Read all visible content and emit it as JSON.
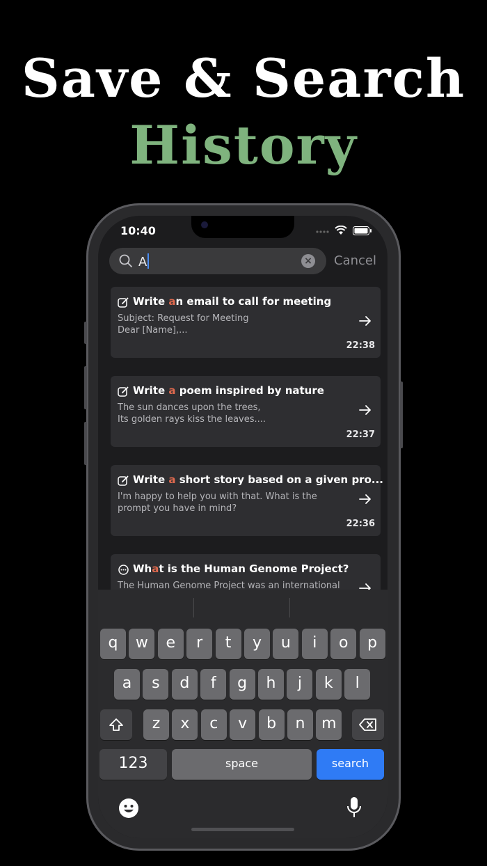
{
  "headline": {
    "line1": "Save & Search",
    "line2": "History"
  },
  "status": {
    "time": "10:40"
  },
  "search": {
    "query": "A",
    "cancel_label": "Cancel"
  },
  "results": [
    {
      "title_pre": "Write ",
      "title_hl": "a",
      "title_post": "n email to call for meeting",
      "line1": "Subject: Request for Meeting",
      "line2": "Dear [Name],...",
      "time": "22:38",
      "icon": "compose-icon"
    },
    {
      "title_pre": "Write ",
      "title_hl": "a",
      "title_post": " poem inspired by nature",
      "line1": "The sun dances upon the trees,",
      "line2": "Its golden rays kiss the leaves....",
      "time": "22:37",
      "icon": "compose-icon"
    },
    {
      "title_pre": "Write ",
      "title_hl": "a",
      "title_post": " short story based on a given pro...",
      "line1": "I'm happy to help you with that. What is the",
      "line2": "prompt you have in mind?",
      "time": "22:36",
      "icon": "compose-icon"
    },
    {
      "title_pre": "Wh",
      "title_hl": "a",
      "title_post": "t is the Human Genome Project?",
      "line1": "The Human Genome Project was an international",
      "line2": "",
      "time": "",
      "icon": "chat-bubble-icon"
    }
  ],
  "keyboard": {
    "row1": [
      "q",
      "w",
      "e",
      "r",
      "t",
      "y",
      "u",
      "i",
      "o",
      "p"
    ],
    "row2": [
      "a",
      "s",
      "d",
      "f",
      "g",
      "h",
      "j",
      "k",
      "l"
    ],
    "row3": [
      "z",
      "x",
      "c",
      "v",
      "b",
      "n",
      "m"
    ],
    "numbers_label": "123",
    "space_label": "space",
    "search_label": "search"
  },
  "colors": {
    "accent_green": "#7fb37e",
    "highlight": "#e06a4f",
    "key_blue": "#2f7bf5"
  }
}
